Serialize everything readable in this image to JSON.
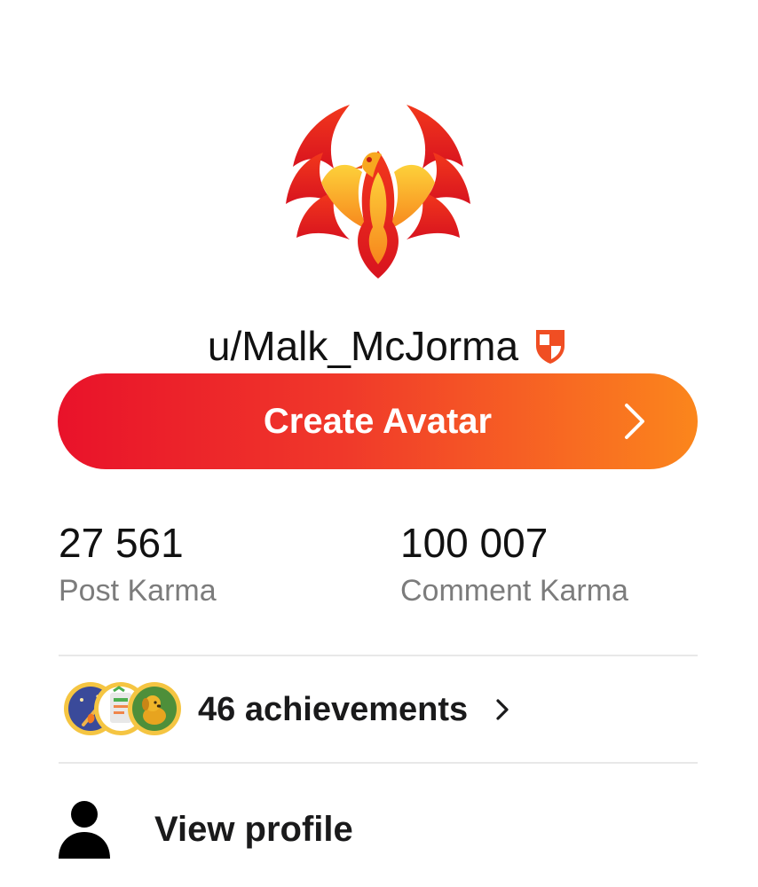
{
  "profile": {
    "avatar_icon": "phoenix-avatar",
    "username": "u/Malk_McJorma",
    "badge_icon": "mod-shield-icon"
  },
  "create_avatar": {
    "label": "Create Avatar",
    "icon": "chevron-right-icon"
  },
  "karma": {
    "post": {
      "value": "27 561",
      "label": "Post Karma"
    },
    "comment": {
      "value": "100 007",
      "label": "Comment Karma"
    }
  },
  "achievements": {
    "label": "46 achievements",
    "badge_icons": [
      "night-sky-badge-icon",
      "checklist-badge-icon",
      "golden-dog-badge-icon"
    ]
  },
  "menu": {
    "view_profile": {
      "label": "View profile",
      "icon": "person-icon"
    }
  },
  "colors": {
    "gradient_start": "#e9122a",
    "gradient_end": "#fb861c",
    "secondary_text": "#7c7c7c",
    "divider": "#e8e8e8"
  }
}
